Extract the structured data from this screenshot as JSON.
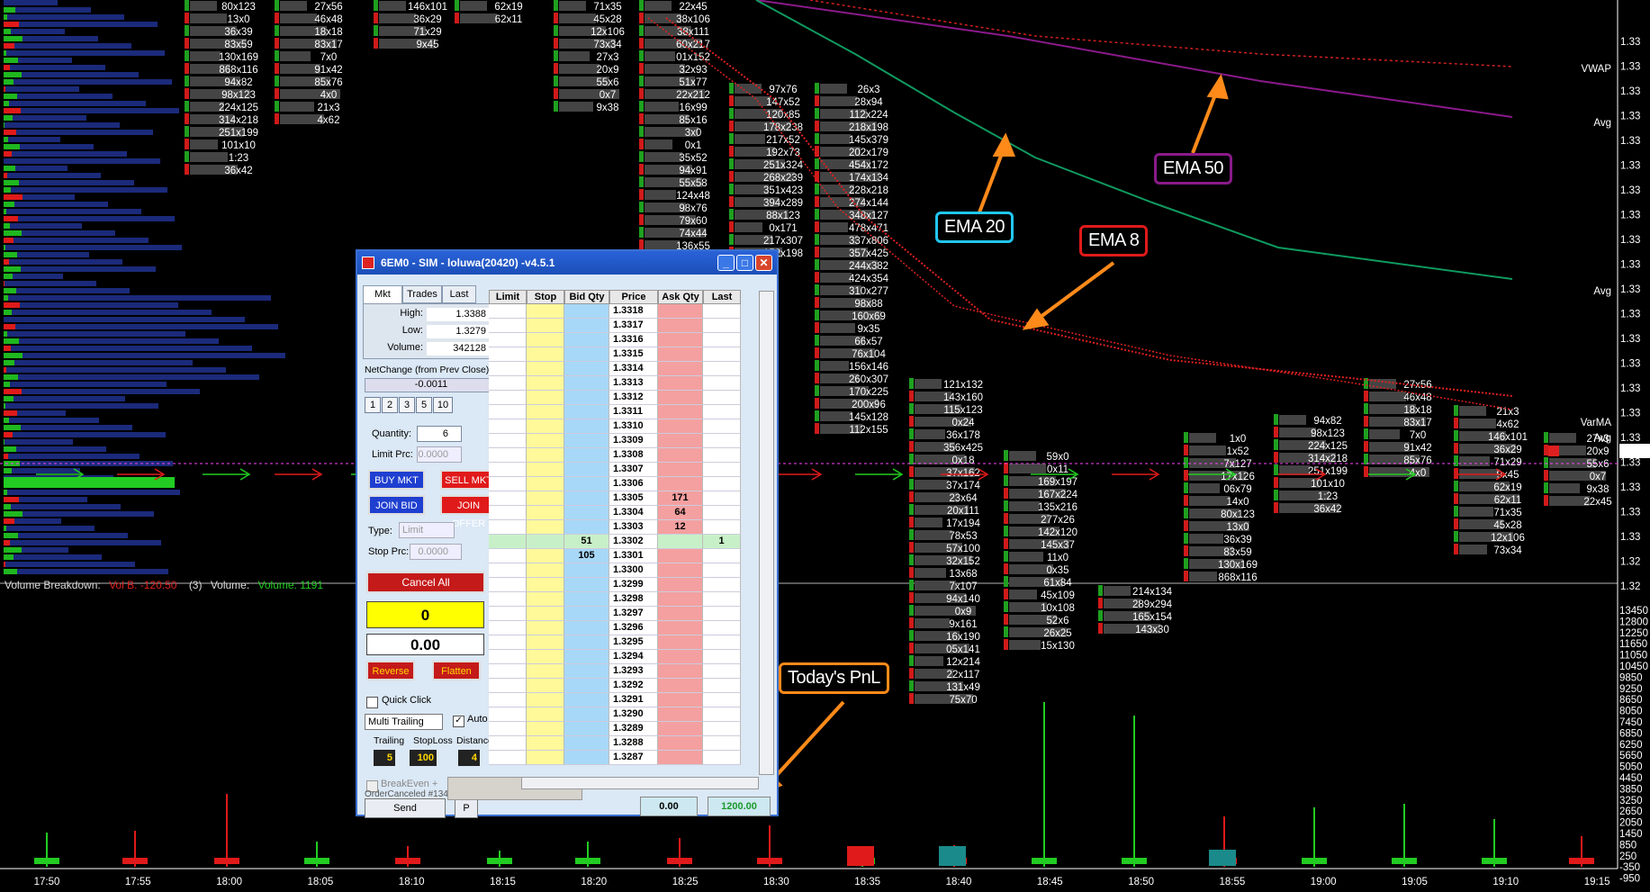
{
  "window": {
    "title": "6EM0 - SIM - loluwa(20420) -v4.5.1",
    "tabs": [
      "Mkt",
      "Trades",
      "Last"
    ],
    "stats": {
      "high_label": "High:",
      "high": "1.3388",
      "low_label": "Low:",
      "low": "1.3279",
      "volume_label": "Volume:",
      "volume": "342128"
    },
    "net_change_label": "NetChange (from Prev Close)",
    "net_change": "-0.0011",
    "qty_presets": [
      "1",
      "2",
      "3",
      "5",
      "10"
    ],
    "quantity_label": "Quantity:",
    "quantity": "6",
    "limit_prc_label": "Limit Prc:",
    "limit_prc": "0.0000",
    "buy_mkt": "BUY MKT",
    "sell_mkt": "SELL MKT",
    "join_bid": "JOIN BID",
    "join_offer": "JOIN OFFER",
    "type_label": "Type:",
    "type_value": "Limit",
    "stop_prc_label": "Stop Prc:",
    "stop_prc": "0.0000",
    "cancel_all": "Cancel All",
    "position": "0",
    "pnl_open": "0.00",
    "reverse": "Reverse",
    "flatten": "Flatten",
    "quick_click": "Quick Click",
    "trailing_mode": "Multi Trailing",
    "auto_label": "Auto",
    "trailing_label": "Trailing",
    "stoploss_label": "StopLoss",
    "distance_label": "Distance",
    "trailing": "5",
    "stoploss": "100",
    "distance": "4",
    "breakeven_label": "BreakEven +",
    "breakeven": "0",
    "order_status": "OrderCanceled #134/",
    "send_multi_exit": "Send MultiExitOrd",
    "p_button": "P",
    "footer_open_pnl": "0.00",
    "footer_today_pnl": "1200.00",
    "ladder_headers": [
      "Limit",
      "Stop",
      "Bid Qty",
      "Price",
      "Ask Qty",
      "Last"
    ],
    "ladder_prices": [
      "1.3318",
      "1.3317",
      "1.3316",
      "1.3315",
      "1.3314",
      "1.3313",
      "1.3312",
      "1.3311",
      "1.3310",
      "1.3309",
      "1.3308",
      "1.3307",
      "1.3306",
      "1.3305",
      "1.3304",
      "1.3303",
      "1.3302",
      "1.3301",
      "1.3300",
      "1.3299",
      "1.3298",
      "1.3297",
      "1.3296",
      "1.3295",
      "1.3294",
      "1.3293",
      "1.3292",
      "1.3291",
      "1.3290",
      "1.3289",
      "1.3288",
      "1.3287"
    ],
    "ask_qty": {
      "1.3305": "171",
      "1.3304": "64",
      "1.3303": "12"
    },
    "bid_qty": {
      "1.3302": "51",
      "1.3301": "105"
    },
    "last_qty": {
      "1.3302": "1"
    }
  },
  "annotations": {
    "ema20": "EMA 20",
    "ema50": "EMA 50",
    "ema8": "EMA 8",
    "todays_pnl": "Today's PnL"
  },
  "volume_breakdown": {
    "label": "Volume Breakdown:",
    "vol_b": "Vol B. -120.50",
    "count": "(3)",
    "volume_label": "Volume:",
    "volume": "Volume: 1191"
  },
  "right_labels": [
    "VWAP",
    "Avg",
    "Avg",
    "VarMA",
    "Avg"
  ],
  "time_axis": [
    "17:50",
    "17:55",
    "18:00",
    "18:05",
    "18:10",
    "18:15",
    "18:20",
    "18:25",
    "18:30",
    "18:35",
    "18:40",
    "18:45",
    "18:50",
    "18:55",
    "19:00",
    "19:05",
    "19:10",
    "19:15"
  ],
  "price_axis": [
    "1.33",
    "1.33",
    "1.33",
    "1.33",
    "1.33",
    "1.33",
    "1.33",
    "1.33",
    "1.33",
    "1.33",
    "1.33",
    "1.33",
    "1.33",
    "1.33",
    "1.33",
    "1.33",
    "1.33",
    "1.33",
    "1.33",
    "1.33",
    "1.33",
    "1.32",
    "1.32"
  ],
  "volume_axis": [
    "13450",
    "12800",
    "12250",
    "11650",
    "11050",
    "10450",
    "9850",
    "9250",
    "8650",
    "8050",
    "7450",
    "6850",
    "6250",
    "5650",
    "5050",
    "4450",
    "3850",
    "3250",
    "2650",
    "2050",
    "1450",
    "850",
    "250",
    "-350",
    "-950"
  ],
  "footprint_labels": [
    "80x123",
    "13x0",
    "36x39",
    "83x59",
    "130x169",
    "868x116",
    "94x82",
    "98x123",
    "224x125",
    "314x218",
    "251x199",
    "101x10",
    "1:23",
    "36x42",
    "27x56",
    "46x48",
    "18x18",
    "83x17",
    "7x0",
    "91x42",
    "85x76",
    "4x0",
    "21x3",
    "4x62",
    "146x101",
    "36x29",
    "71x29",
    "9x45",
    "62x19",
    "62x11",
    "71x35",
    "45x28",
    "12x106",
    "73x34",
    "27x3",
    "20x9",
    "55x6",
    "0x7",
    "9x38",
    "22x45",
    "38x106",
    "38x111",
    "60x217",
    "01x152",
    "32x93",
    "51x77",
    "22x212",
    "16x99",
    "85x16",
    "3x0",
    "0x1",
    "35x52",
    "94x91",
    "55x58",
    "124x48",
    "98x76",
    "79x60",
    "74x44",
    "136x55",
    "56x125",
    "62x61",
    "97x76",
    "147x52",
    "120x85",
    "178x238",
    "217x52",
    "192x73",
    "251x324",
    "268x239",
    "351x423",
    "394x289",
    "88x123",
    "0x171",
    "217x307",
    "152x198",
    "26x3",
    "28x94",
    "112x224",
    "218x198",
    "145x379",
    "202x179",
    "454x172",
    "174x134",
    "228x218",
    "274x144",
    "348x127",
    "478x471",
    "337x806",
    "357x425",
    "244x382",
    "424x354",
    "310x277",
    "98x88",
    "160x69",
    "9x35",
    "66x57",
    "76x104",
    "156x146",
    "260x307",
    "170x225",
    "200x96",
    "145x128",
    "112x155",
    "121x132",
    "143x160",
    "115x123",
    "0x24",
    "36x178",
    "356x425",
    "0x18",
    "37x162",
    "37x174",
    "23x64",
    "20x111",
    "17x194",
    "78x53",
    "57x100",
    "32x152",
    "13x68",
    "7x107",
    "94x140",
    "0x9",
    "9x161",
    "16x190",
    "05x141",
    "12x214",
    "22x117",
    "131x49",
    "75x70",
    "59x0",
    "0x11",
    "169x197",
    "167x224",
    "135x216",
    "277x26",
    "142x120",
    "145x37",
    "11x0",
    "0x35",
    "61x84",
    "45x109",
    "10x108",
    "52x6",
    "26x25",
    "15x130",
    "214x134",
    "289x294",
    "165x154",
    "143x30",
    "1x0",
    "1x52",
    "7x127",
    "17x126",
    "06x79",
    "14x0"
  ]
}
